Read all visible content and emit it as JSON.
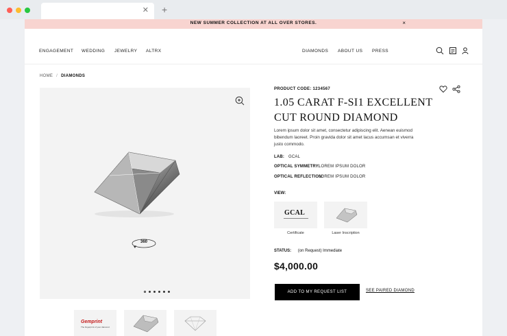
{
  "promo": {
    "text": "NEW SUMMER COLLECTION  AT ALL OVER STORES.",
    "close": "×"
  },
  "nav": {
    "left": [
      "ENGAGEMENT",
      "WEDDING",
      "JEWELRY",
      "ALTRX"
    ],
    "right": [
      "DIAMONDS",
      "ABOUT US",
      "PRESS"
    ]
  },
  "breadcrumb": {
    "home": "HOME",
    "separator": "/",
    "current": "DIAMONDS"
  },
  "gallery": {
    "spin_label": "360",
    "dot_count": 6,
    "active_dot": 0,
    "thumbnails": [
      {
        "brand": "Gemprint",
        "sub": "The fingerprint of your diamond"
      },
      {
        "brand": "",
        "sub": ""
      },
      {
        "brand": "",
        "sub": ""
      }
    ]
  },
  "product": {
    "code_label": "PRODUCT CODE: 1234567",
    "title": "1.05 CARAT F-SI1 EXCELLENT CUT ROUND DIAMOND",
    "description": "Lorem ipsum dolor sit amet, consectetur adipiscing elit. Aenean euismod bibendum laoreet. Proin gravida dolor sit amet lacus accumsan et viverra justo commodo.",
    "specs": {
      "lab": {
        "label": "LAB:",
        "value": "GCAL"
      },
      "symmetry": {
        "label": "OPTICAL SYMMETRY:",
        "value": "LOREM IPSUM DOLOR"
      },
      "reflection": {
        "label": "OPTICAL REFLECTION:",
        "value": "LOREM IPSUM DOLOR"
      }
    },
    "view_label": "VIEW:",
    "views": [
      {
        "logo": "GCAL",
        "caption": "Certificate"
      },
      {
        "logo": "",
        "caption": "Laser Inscription"
      }
    ],
    "status_label": "STATUS:",
    "status_value": "(on Request) Immediate",
    "price": "$4,000.00",
    "cta": "ADD TO MY REQUEST LIST",
    "paired": "SEE PAIRED DIAMOND"
  },
  "icons": {
    "search": "search-icon",
    "account": "account-icon",
    "user": "user-icon",
    "heart": "heart-icon",
    "share": "share-icon",
    "zoom": "zoom-icon"
  },
  "colors": {
    "promo_bg": "#f8d4d0",
    "cta_bg": "#000000",
    "gallery_bg": "#f3f3f3"
  }
}
